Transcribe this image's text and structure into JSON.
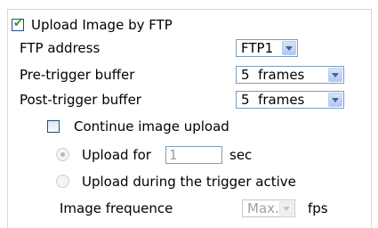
{
  "upload_ftp": {
    "label": "Upload Image by FTP",
    "checked": true
  },
  "ftp_address": {
    "label": "FTP address",
    "value": "FTP1"
  },
  "pre_trigger": {
    "label": "Pre-trigger buffer",
    "value": "5  frames"
  },
  "post_trigger": {
    "label": "Post-trigger buffer",
    "value": "5  frames"
  },
  "continue_upload": {
    "label": "Continue image upload",
    "checked": false
  },
  "upload_for": {
    "label": "Upload for",
    "value": "1",
    "unit": "sec",
    "selected": true
  },
  "upload_during": {
    "label": "Upload during the trigger active",
    "selected": false
  },
  "image_frequence": {
    "label": "Image frequence",
    "value": "Max.",
    "unit": "fps"
  }
}
